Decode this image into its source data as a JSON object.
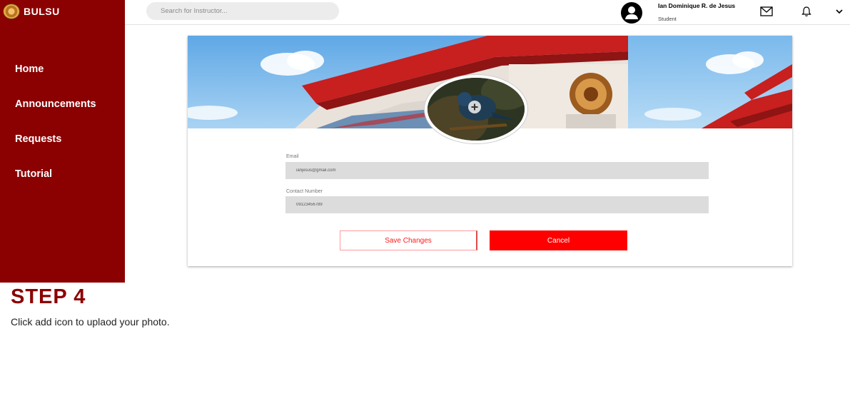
{
  "brand": {
    "name": "BULSU"
  },
  "sidebar": {
    "items": [
      {
        "label": "Home"
      },
      {
        "label": "Announcements"
      },
      {
        "label": "Requests"
      },
      {
        "label": "Tutorial"
      }
    ]
  },
  "topbar": {
    "search_placeholder": "Search for Instructor...",
    "user_name": "Ian Dominique R. de Jesus",
    "user_role": "Student",
    "icons": [
      "user-avatar-icon",
      "mail-icon",
      "bell-icon",
      "chevron-down-icon"
    ]
  },
  "profile_form": {
    "email_label": "Email",
    "email_value": "ianjesus@gmail.com",
    "contact_label": "Contact Number",
    "contact_value": "09123456789",
    "save_label": "Save Changes",
    "cancel_label": "Cancel",
    "add_photo_icon": "add-circle-icon"
  },
  "colors": {
    "sidebar": "#8b0000",
    "accent": "#ff0000",
    "step_title": "#8b0000"
  },
  "step": {
    "title": "STEP 4",
    "description": "Click add icon to uplaod your photo."
  }
}
